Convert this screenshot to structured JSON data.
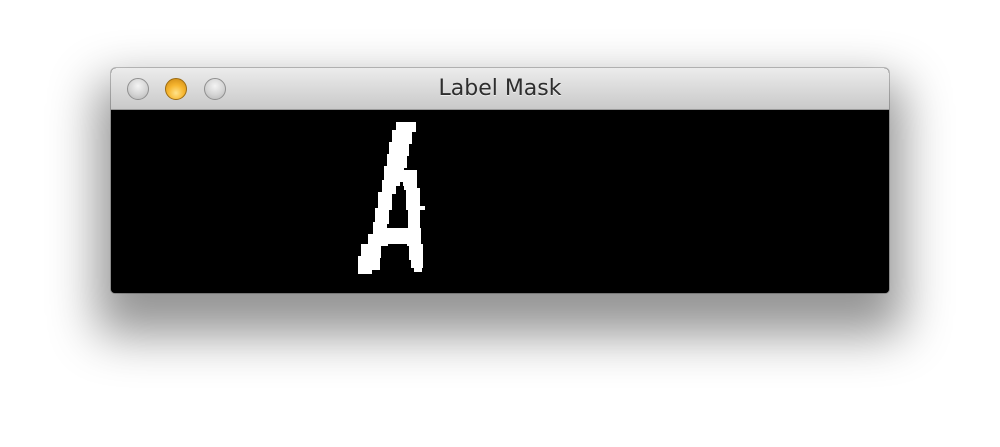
{
  "window": {
    "title": "Label Mask"
  },
  "titlebar": {
    "buttons": [
      {
        "name": "close",
        "icon": "close-icon"
      },
      {
        "name": "minimize",
        "icon": "minimize-icon"
      },
      {
        "name": "zoom",
        "icon": "zoom-icon"
      }
    ]
  },
  "canvas": {
    "background": "#000000",
    "mask_color": "#ffffff"
  }
}
